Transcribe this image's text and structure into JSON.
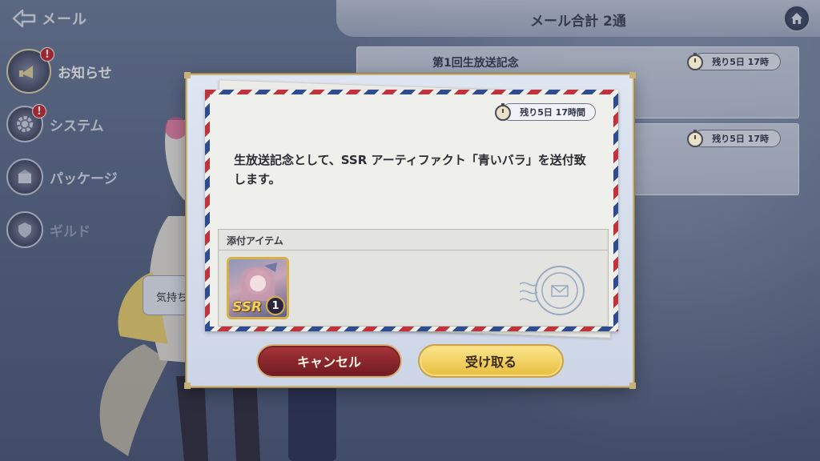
{
  "header": {
    "back_label": "メール",
    "mail_total": "メール合計 2通"
  },
  "sidebar": {
    "items": [
      {
        "label": "お知らせ",
        "badge": "!",
        "icon": "announcement-icon"
      },
      {
        "label": "システム",
        "badge": "!",
        "icon": "gear-icon"
      },
      {
        "label": "パッケージ",
        "icon": "package-icon"
      },
      {
        "label": "ギルド",
        "icon": "guild-icon"
      }
    ]
  },
  "mail_list": {
    "items": [
      {
        "title": "第1回生放送記念",
        "timer": "残り5日 17時"
      },
      {
        "title": "",
        "timer": "残り5日 17時"
      }
    ]
  },
  "bubble_text": "気持ち",
  "modal": {
    "timer": "残り5日 17時間",
    "message": "生放送記念として、SSR アーティファクト「青いバラ」を送付致します。",
    "attachment_header": "添付アイテム",
    "item": {
      "rarity": "SSR",
      "count": "1"
    },
    "cancel_label": "キャンセル",
    "receive_label": "受け取る"
  },
  "colors": {
    "cancel_button": "#8a2a30",
    "receive_button": "#f2d36a",
    "frame_gold": "#c9b17a"
  }
}
